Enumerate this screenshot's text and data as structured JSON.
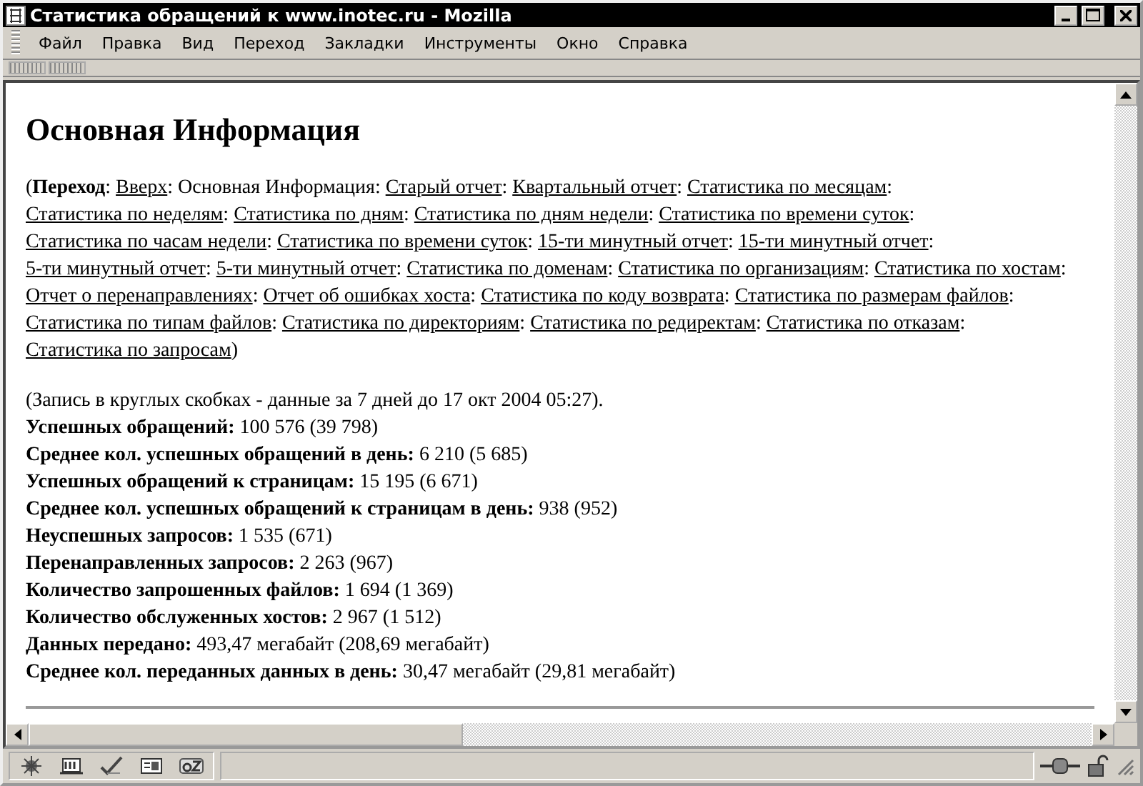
{
  "window": {
    "title": "Статистика обращений к www.inotec.ru - Mozilla"
  },
  "menu": [
    "Файл",
    "Правка",
    "Вид",
    "Переход",
    "Закладки",
    "Инструменты",
    "Окно",
    "Справка"
  ],
  "heading": "Основная Информация",
  "nav": {
    "open": "(",
    "label": "Переход",
    "label_after": ":",
    "items": [
      {
        "kind": "link",
        "text": "Вверх",
        "after": ":"
      },
      {
        "kind": "current",
        "text": "Основная Информация",
        "after": ":"
      },
      {
        "kind": "link",
        "text": "Старый отчет",
        "after": ":"
      },
      {
        "kind": "link",
        "text": "Квартальный отчет",
        "after": ":"
      },
      {
        "kind": "link",
        "text": "Статистика по месяцам",
        "after": ":"
      },
      {
        "kind": "link",
        "text": "Статистика по неделям",
        "after": ":"
      },
      {
        "kind": "link",
        "text": "Статистика по дням",
        "after": ":"
      },
      {
        "kind": "link",
        "text": "Статистика по дням недели",
        "after": ":"
      },
      {
        "kind": "link",
        "text": "Статистика по времени суток",
        "after": ":"
      },
      {
        "kind": "link",
        "text": "Статистика по часам недели",
        "after": ":"
      },
      {
        "kind": "link",
        "text": "Статистика по времени суток",
        "after": ":"
      },
      {
        "kind": "link",
        "text": "15-ти минутный отчет",
        "after": ":"
      },
      {
        "kind": "link",
        "text": "15-ти минутный отчет",
        "after": ":"
      },
      {
        "kind": "link",
        "text": "5-ти минутный отчет",
        "after": ":"
      },
      {
        "kind": "link",
        "text": "5-ти минутный отчет",
        "after": ":"
      },
      {
        "kind": "link",
        "text": "Статистика по доменам",
        "after": ":"
      },
      {
        "kind": "link",
        "text": "Статистика по организациям",
        "after": ":"
      },
      {
        "kind": "link",
        "text": "Статистика по хостам",
        "after": ":"
      },
      {
        "kind": "link",
        "text": "Отчет о перенаправлениях",
        "after": ":"
      },
      {
        "kind": "link",
        "text": "Отчет об ошибках хоста",
        "after": ":"
      },
      {
        "kind": "link",
        "text": "Статистика по коду возврата",
        "after": ":"
      },
      {
        "kind": "link",
        "text": "Статистика по размерам файлов",
        "after": ":"
      },
      {
        "kind": "link",
        "text": "Статистика по типам файлов",
        "after": ":"
      },
      {
        "kind": "link",
        "text": "Статистика по директориям",
        "after": ":"
      },
      {
        "kind": "link",
        "text": "Статистика по редиректам",
        "after": ":"
      },
      {
        "kind": "link",
        "text": "Статистика по отказам",
        "after": ":"
      },
      {
        "kind": "link",
        "text": "Статистика по запросам",
        "after": ")"
      }
    ]
  },
  "note": "(Запись в круглых скобках - данные за 7 дней до 17 окт 2004 05:27).",
  "stats": [
    {
      "label": "Успешных обращений:",
      "value": "100 576 (39 798)"
    },
    {
      "label": "Среднее кол. успешных обращений в день:",
      "value": "6 210 (5 685)"
    },
    {
      "label": "Успешных обращений к страницам:",
      "value": "15 195 (6 671)"
    },
    {
      "label": "Среднее кол. успешных обращений к страницам в день:",
      "value": "938 (952)"
    },
    {
      "label": "Неуспешных запросов:",
      "value": "1 535 (671)"
    },
    {
      "label": "Перенаправленных запросов:",
      "value": "2 263 (967)"
    },
    {
      "label": "Количество запрошенных файлов:",
      "value": "1 694 (1 369)"
    },
    {
      "label": "Количество обслуженных хостов:",
      "value": "2 967 (1 512)"
    },
    {
      "label": "Данных передано:",
      "value": "493,47 мегабайт (208,69 мегабайт)"
    },
    {
      "label": "Среднее кол. переданных данных в день:",
      "value": "30,47 мегабайт (29,81 мегабайт)"
    }
  ]
}
